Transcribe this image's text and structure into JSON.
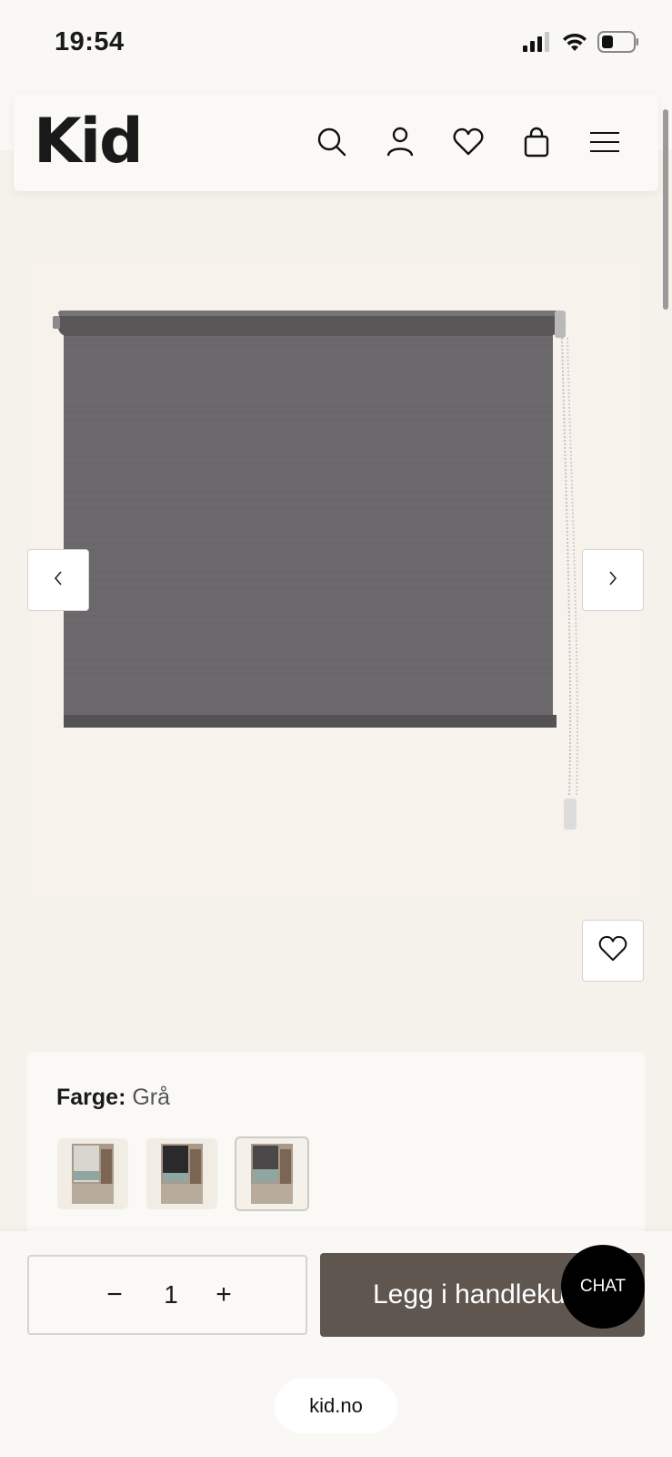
{
  "status_bar": {
    "time": "19:54",
    "icons": [
      "signal-icon",
      "wifi-icon",
      "battery-icon"
    ]
  },
  "header": {
    "logo": "Kid",
    "icons": [
      "search-icon",
      "user-icon",
      "heart-icon",
      "bag-icon",
      "menu-icon"
    ]
  },
  "gallery": {
    "prev_icon": "chevron-left-icon",
    "next_icon": "chevron-right-icon",
    "favorite_icon": "heart-icon"
  },
  "color_selector": {
    "label": "Farge:",
    "value": "Grå",
    "swatches": [
      {
        "name": "light",
        "selected": false
      },
      {
        "name": "dark",
        "selected": false
      },
      {
        "name": "grey",
        "selected": true
      }
    ]
  },
  "purchase": {
    "minus_symbol": "−",
    "quantity": "1",
    "plus_symbol": "+",
    "add_to_cart_label": "Legg i handlekurv",
    "chat_label": "CHAT"
  },
  "browser": {
    "url": "kid.no"
  },
  "colors": {
    "page_bg": "#f5f1eb",
    "cart_button": "#5f5650",
    "blind_grey": "#6b686b",
    "chat_bg": "#000000"
  }
}
